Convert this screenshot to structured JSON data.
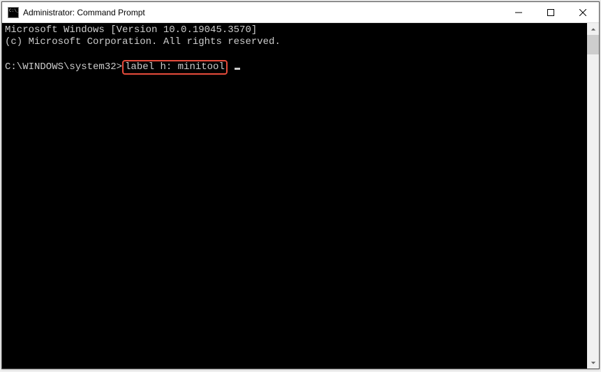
{
  "window": {
    "title": "Administrator: Command Prompt"
  },
  "terminal": {
    "line1": "Microsoft Windows [Version 10.0.19045.3570]",
    "line2": "(c) Microsoft Corporation. All rights reserved.",
    "blank": "",
    "prompt": "C:\\WINDOWS\\system32>",
    "command": "label h: minitool"
  }
}
